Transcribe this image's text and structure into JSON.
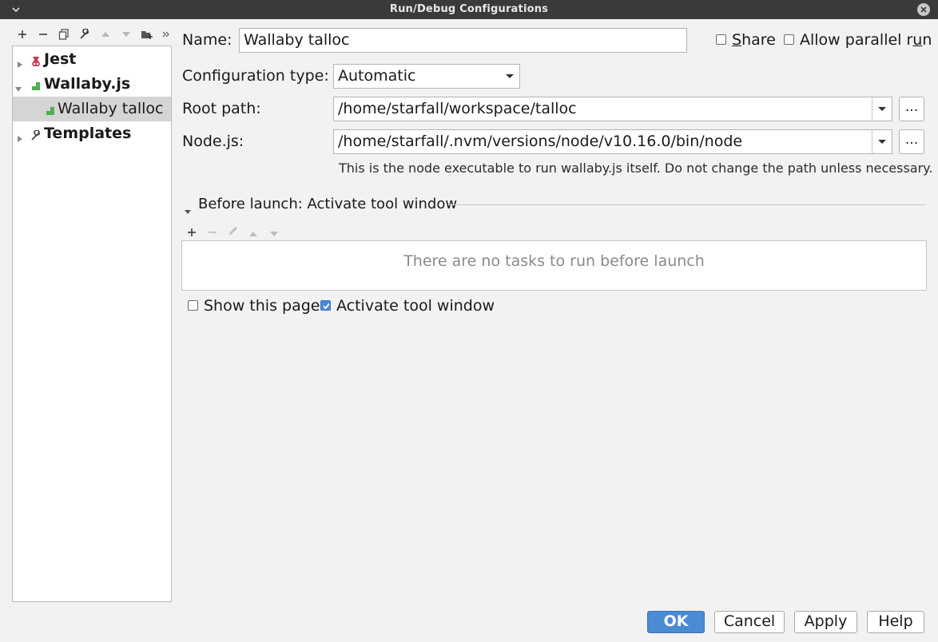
{
  "window": {
    "title": "Run/Debug Configurations"
  },
  "tree": {
    "items": [
      {
        "label": "Jest",
        "icon": "jest-icon",
        "expanded": false,
        "bold": true
      },
      {
        "label": "Wallaby.js",
        "icon": "wallaby-icon",
        "expanded": true,
        "bold": true
      },
      {
        "label": "Wallaby talloc",
        "icon": "wallaby-icon",
        "selected": true,
        "bold": false
      },
      {
        "label": "Templates",
        "icon": "wrench-icon",
        "expanded": false,
        "bold": true
      }
    ]
  },
  "form": {
    "name_label": "Name:",
    "name_value": "Wallaby talloc",
    "share_prefix": "",
    "share_mnemonic": "S",
    "share_rest": "hare",
    "share_checked": false,
    "parallel_prefix": "Allow parallel r",
    "parallel_mnemonic": "u",
    "parallel_rest": "n",
    "parallel_checked": false,
    "config_type_label": "Configuration type:",
    "config_type_value": "Automatic",
    "root_path_label": "Root path:",
    "root_path_value": "/home/starfall/workspace/talloc",
    "node_label": "Node.js:",
    "node_value": "/home/starfall/.nvm/versions/node/v10.16.0/bin/node",
    "node_hint": "This is the node executable to run wallaby.js itself. Do not change the path unless necessary.",
    "browse_label": "..."
  },
  "before_launch": {
    "title": "Before launch: Activate tool window",
    "empty_text": "There are no tasks to run before launch",
    "show_page_label": "Show this page",
    "show_page_checked": false,
    "activate_label": "Activate tool window",
    "activate_checked": true
  },
  "buttons": {
    "ok": "OK",
    "cancel": "Cancel",
    "apply": "Apply",
    "help": "Help"
  },
  "colors": {
    "accent": "#4a8bd4",
    "wallaby_green": "#4caf50",
    "jest_red": "#c63d54"
  }
}
